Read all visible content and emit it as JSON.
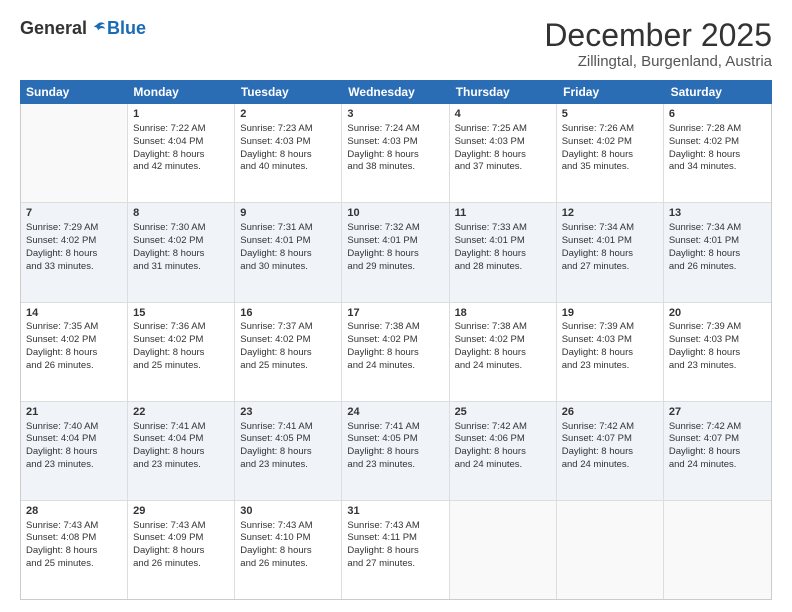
{
  "logo": {
    "general": "General",
    "blue": "Blue"
  },
  "header": {
    "month": "December 2025",
    "location": "Zillingtal, Burgenland, Austria"
  },
  "days": [
    "Sunday",
    "Monday",
    "Tuesday",
    "Wednesday",
    "Thursday",
    "Friday",
    "Saturday"
  ],
  "weeks": [
    [
      {
        "num": "",
        "info": ""
      },
      {
        "num": "1",
        "info": "Sunrise: 7:22 AM\nSunset: 4:04 PM\nDaylight: 8 hours\nand 42 minutes."
      },
      {
        "num": "2",
        "info": "Sunrise: 7:23 AM\nSunset: 4:03 PM\nDaylight: 8 hours\nand 40 minutes."
      },
      {
        "num": "3",
        "info": "Sunrise: 7:24 AM\nSunset: 4:03 PM\nDaylight: 8 hours\nand 38 minutes."
      },
      {
        "num": "4",
        "info": "Sunrise: 7:25 AM\nSunset: 4:03 PM\nDaylight: 8 hours\nand 37 minutes."
      },
      {
        "num": "5",
        "info": "Sunrise: 7:26 AM\nSunset: 4:02 PM\nDaylight: 8 hours\nand 35 minutes."
      },
      {
        "num": "6",
        "info": "Sunrise: 7:28 AM\nSunset: 4:02 PM\nDaylight: 8 hours\nand 34 minutes."
      }
    ],
    [
      {
        "num": "7",
        "info": "Sunrise: 7:29 AM\nSunset: 4:02 PM\nDaylight: 8 hours\nand 33 minutes."
      },
      {
        "num": "8",
        "info": "Sunrise: 7:30 AM\nSunset: 4:02 PM\nDaylight: 8 hours\nand 31 minutes."
      },
      {
        "num": "9",
        "info": "Sunrise: 7:31 AM\nSunset: 4:01 PM\nDaylight: 8 hours\nand 30 minutes."
      },
      {
        "num": "10",
        "info": "Sunrise: 7:32 AM\nSunset: 4:01 PM\nDaylight: 8 hours\nand 29 minutes."
      },
      {
        "num": "11",
        "info": "Sunrise: 7:33 AM\nSunset: 4:01 PM\nDaylight: 8 hours\nand 28 minutes."
      },
      {
        "num": "12",
        "info": "Sunrise: 7:34 AM\nSunset: 4:01 PM\nDaylight: 8 hours\nand 27 minutes."
      },
      {
        "num": "13",
        "info": "Sunrise: 7:34 AM\nSunset: 4:01 PM\nDaylight: 8 hours\nand 26 minutes."
      }
    ],
    [
      {
        "num": "14",
        "info": "Sunrise: 7:35 AM\nSunset: 4:02 PM\nDaylight: 8 hours\nand 26 minutes."
      },
      {
        "num": "15",
        "info": "Sunrise: 7:36 AM\nSunset: 4:02 PM\nDaylight: 8 hours\nand 25 minutes."
      },
      {
        "num": "16",
        "info": "Sunrise: 7:37 AM\nSunset: 4:02 PM\nDaylight: 8 hours\nand 25 minutes."
      },
      {
        "num": "17",
        "info": "Sunrise: 7:38 AM\nSunset: 4:02 PM\nDaylight: 8 hours\nand 24 minutes."
      },
      {
        "num": "18",
        "info": "Sunrise: 7:38 AM\nSunset: 4:02 PM\nDaylight: 8 hours\nand 24 minutes."
      },
      {
        "num": "19",
        "info": "Sunrise: 7:39 AM\nSunset: 4:03 PM\nDaylight: 8 hours\nand 23 minutes."
      },
      {
        "num": "20",
        "info": "Sunrise: 7:39 AM\nSunset: 4:03 PM\nDaylight: 8 hours\nand 23 minutes."
      }
    ],
    [
      {
        "num": "21",
        "info": "Sunrise: 7:40 AM\nSunset: 4:04 PM\nDaylight: 8 hours\nand 23 minutes."
      },
      {
        "num": "22",
        "info": "Sunrise: 7:41 AM\nSunset: 4:04 PM\nDaylight: 8 hours\nand 23 minutes."
      },
      {
        "num": "23",
        "info": "Sunrise: 7:41 AM\nSunset: 4:05 PM\nDaylight: 8 hours\nand 23 minutes."
      },
      {
        "num": "24",
        "info": "Sunrise: 7:41 AM\nSunset: 4:05 PM\nDaylight: 8 hours\nand 23 minutes."
      },
      {
        "num": "25",
        "info": "Sunrise: 7:42 AM\nSunset: 4:06 PM\nDaylight: 8 hours\nand 24 minutes."
      },
      {
        "num": "26",
        "info": "Sunrise: 7:42 AM\nSunset: 4:07 PM\nDaylight: 8 hours\nand 24 minutes."
      },
      {
        "num": "27",
        "info": "Sunrise: 7:42 AM\nSunset: 4:07 PM\nDaylight: 8 hours\nand 24 minutes."
      }
    ],
    [
      {
        "num": "28",
        "info": "Sunrise: 7:43 AM\nSunset: 4:08 PM\nDaylight: 8 hours\nand 25 minutes."
      },
      {
        "num": "29",
        "info": "Sunrise: 7:43 AM\nSunset: 4:09 PM\nDaylight: 8 hours\nand 26 minutes."
      },
      {
        "num": "30",
        "info": "Sunrise: 7:43 AM\nSunset: 4:10 PM\nDaylight: 8 hours\nand 26 minutes."
      },
      {
        "num": "31",
        "info": "Sunrise: 7:43 AM\nSunset: 4:11 PM\nDaylight: 8 hours\nand 27 minutes."
      },
      {
        "num": "",
        "info": ""
      },
      {
        "num": "",
        "info": ""
      },
      {
        "num": "",
        "info": ""
      }
    ]
  ]
}
